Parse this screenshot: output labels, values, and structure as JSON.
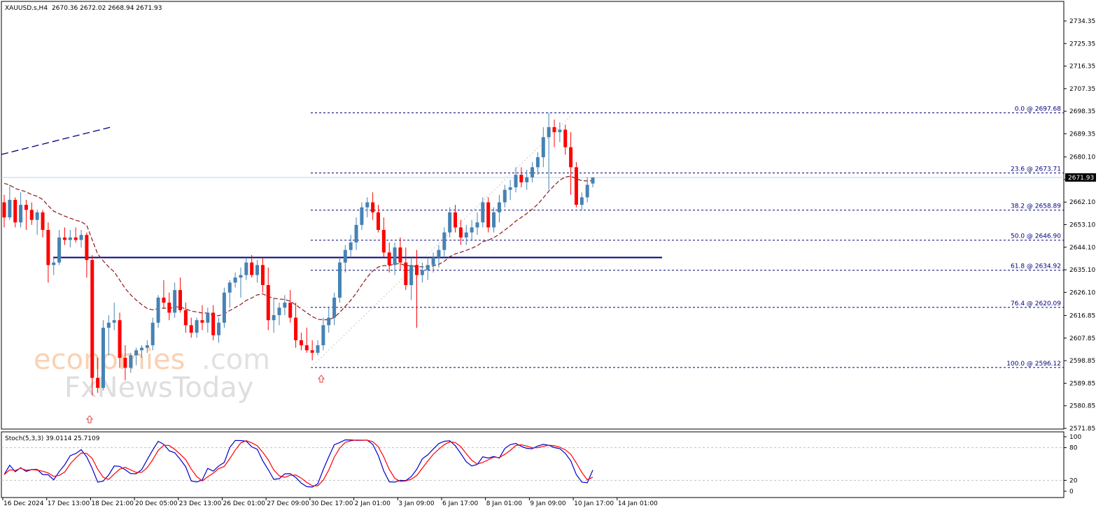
{
  "header": {
    "symbol": "XAUUSD.s,H4",
    "ohlc": "2670.36 2672.02 2668.94 2671.93"
  },
  "chart_data": {
    "type": "candlestick",
    "symbol": "XAUUSD.s",
    "timeframe": "H4",
    "price_axis": {
      "ticks": [
        "2734.35",
        "2725.35",
        "2716.35",
        "2707.35",
        "2698.35",
        "2689.35",
        "2680.10",
        "2671.10",
        "2662.10",
        "2653.10",
        "2644.10",
        "2635.10",
        "2626.10",
        "2616.85",
        "2607.85",
        "2598.85",
        "2589.85",
        "2580.85",
        "2571.85"
      ],
      "range": [
        2571.85,
        2739.0
      ]
    },
    "current_price": {
      "value": 2671.93,
      "label": "2671.93"
    },
    "time_axis": [
      "16 Dec 2024",
      "17 Dec 13:00",
      "18 Dec 21:00",
      "20 Dec 05:00",
      "23 Dec 13:00",
      "26 Dec 01:00",
      "27 Dec 09:00",
      "30 Dec 17:00",
      "2 Jan 01:00",
      "3 Jan 09:00",
      "6 Jan 17:00",
      "8 Jan 01:00",
      "9 Jan 09:00",
      "10 Jan 17:00",
      "14 Jan 01:00"
    ],
    "fibonacci": [
      {
        "label": "0.0 @ 2697.68",
        "price": 2697.68
      },
      {
        "label": "23.6 @ 2673.71",
        "price": 2673.71
      },
      {
        "label": "38.2 @ 2658.89",
        "price": 2658.89
      },
      {
        "label": "50.0 @ 2646.90",
        "price": 2646.9
      },
      {
        "label": "61.8 @ 2634.92",
        "price": 2634.92
      },
      {
        "label": "76.4 @ 2620.09",
        "price": 2620.09
      },
      {
        "label": "100.0 @ 2596.12",
        "price": 2596.12
      }
    ],
    "support_line": {
      "price": 2640.0
    },
    "colors": {
      "bull": "#4682b4",
      "bear": "#ff0000",
      "ma": "#8b1a1a",
      "fib": "#000080",
      "support": "#000080",
      "stoch_main": "#0000cd",
      "stoch_signal": "#ff0000"
    },
    "candles": [
      [
        2662,
        2665,
        2652,
        2656
      ],
      [
        2656,
        2669,
        2655,
        2663
      ],
      [
        2663,
        2664,
        2652,
        2654
      ],
      [
        2654,
        2666,
        2652,
        2661
      ],
      [
        2661,
        2663,
        2651,
        2659
      ],
      [
        2659,
        2662,
        2653,
        2655
      ],
      [
        2655,
        2659,
        2649,
        2658
      ],
      [
        2658,
        2659,
        2648,
        2651
      ],
      [
        2651,
        2654,
        2630,
        2637
      ],
      [
        2637,
        2640,
        2633,
        2638
      ],
      [
        2638,
        2651,
        2637,
        2648
      ],
      [
        2648,
        2652,
        2645,
        2647
      ],
      [
        2647,
        2651,
        2644,
        2648
      ],
      [
        2648,
        2652,
        2646,
        2647
      ],
      [
        2647,
        2651,
        2644,
        2649
      ],
      [
        2649,
        2650,
        2632,
        2639
      ],
      [
        2639,
        2641,
        2585,
        2592
      ],
      [
        2592,
        2600,
        2586,
        2588
      ],
      [
        2588,
        2615,
        2587,
        2612
      ],
      [
        2612,
        2617,
        2601,
        2614
      ],
      [
        2614,
        2622,
        2611,
        2615
      ],
      [
        2615,
        2618,
        2596,
        2600
      ],
      [
        2600,
        2605,
        2591,
        2596
      ],
      [
        2596,
        2602,
        2594,
        2601
      ],
      [
        2601,
        2604,
        2597,
        2603
      ],
      [
        2603,
        2605,
        2600,
        2604
      ],
      [
        2604,
        2607,
        2602,
        2605
      ],
      [
        2605,
        2616,
        2603,
        2614
      ],
      [
        2614,
        2625,
        2612,
        2624
      ],
      [
        2624,
        2631,
        2620,
        2622
      ],
      [
        2622,
        2626,
        2615,
        2618
      ],
      [
        2618,
        2630,
        2616,
        2627
      ],
      [
        2627,
        2632,
        2618,
        2619
      ],
      [
        2619,
        2622,
        2610,
        2613
      ],
      [
        2613,
        2616,
        2608,
        2610
      ],
      [
        2610,
        2616,
        2608,
        2615
      ],
      [
        2615,
        2621,
        2611,
        2614
      ],
      [
        2614,
        2620,
        2610,
        2618
      ],
      [
        2618,
        2621,
        2607,
        2609
      ],
      [
        2609,
        2616,
        2606,
        2614
      ],
      [
        2614,
        2628,
        2612,
        2626
      ],
      [
        2626,
        2631,
        2620,
        2630
      ],
      [
        2630,
        2634,
        2628,
        2632
      ],
      [
        2632,
        2636,
        2624,
        2633
      ],
      [
        2633,
        2640,
        2631,
        2638
      ],
      [
        2638,
        2641,
        2632,
        2633
      ],
      [
        2633,
        2639,
        2630,
        2637
      ],
      [
        2637,
        2640,
        2626,
        2629
      ],
      [
        2629,
        2636,
        2611,
        2615
      ],
      [
        2615,
        2624,
        2610,
        2617
      ],
      [
        2617,
        2622,
        2613,
        2620
      ],
      [
        2620,
        2625,
        2617,
        2622
      ],
      [
        2622,
        2627,
        2614,
        2616
      ],
      [
        2616,
        2622,
        2604,
        2607
      ],
      [
        2607,
        2610,
        2603,
        2605
      ],
      [
        2605,
        2612,
        2602,
        2603
      ],
      [
        2603,
        2607,
        2599,
        2602
      ],
      [
        2602,
        2607,
        2601,
        2605
      ],
      [
        2605,
        2616,
        2603,
        2613
      ],
      [
        2613,
        2620,
        2610,
        2616
      ],
      [
        2616,
        2626,
        2613,
        2624
      ],
      [
        2624,
        2640,
        2622,
        2638
      ],
      [
        2638,
        2645,
        2634,
        2643
      ],
      [
        2643,
        2649,
        2640,
        2646
      ],
      [
        2646,
        2656,
        2643,
        2653
      ],
      [
        2653,
        2662,
        2651,
        2660
      ],
      [
        2660,
        2664,
        2656,
        2662
      ],
      [
        2662,
        2666,
        2655,
        2658
      ],
      [
        2658,
        2661,
        2650,
        2651
      ],
      [
        2651,
        2656,
        2640,
        2642
      ],
      [
        2642,
        2646,
        2634,
        2637
      ],
      [
        2637,
        2646,
        2633,
        2644
      ],
      [
        2644,
        2648,
        2635,
        2638
      ],
      [
        2638,
        2644,
        2627,
        2629
      ],
      [
        2629,
        2640,
        2623,
        2637
      ],
      [
        2637,
        2643,
        2612,
        2633
      ],
      [
        2633,
        2638,
        2630,
        2635
      ],
      [
        2635,
        2640,
        2631,
        2637
      ],
      [
        2637,
        2642,
        2634,
        2640
      ],
      [
        2640,
        2645,
        2636,
        2643
      ],
      [
        2643,
        2652,
        2640,
        2650
      ],
      [
        2650,
        2660,
        2648,
        2658
      ],
      [
        2658,
        2661,
        2650,
        2652
      ],
      [
        2652,
        2655,
        2645,
        2648
      ],
      [
        2648,
        2653,
        2645,
        2650
      ],
      [
        2650,
        2655,
        2647,
        2652
      ],
      [
        2652,
        2658,
        2649,
        2654
      ],
      [
        2654,
        2664,
        2652,
        2662
      ],
      [
        2662,
        2664,
        2650,
        2652
      ],
      [
        2652,
        2660,
        2650,
        2658
      ],
      [
        2658,
        2665,
        2654,
        2662
      ],
      [
        2662,
        2669,
        2660,
        2667
      ],
      [
        2667,
        2671,
        2663,
        2668
      ],
      [
        2668,
        2676,
        2666,
        2673
      ],
      [
        2673,
        2676,
        2668,
        2670
      ],
      [
        2670,
        2675,
        2667,
        2672
      ],
      [
        2672,
        2678,
        2670,
        2676
      ],
      [
        2676,
        2682,
        2673,
        2680
      ],
      [
        2680,
        2692,
        2676,
        2688
      ],
      [
        2688,
        2697.68,
        2667,
        2692
      ],
      [
        2692,
        2695,
        2684,
        2690
      ],
      [
        2690,
        2694,
        2686,
        2691
      ],
      [
        2691,
        2693,
        2681,
        2684
      ],
      [
        2684,
        2690,
        2665,
        2676
      ],
      [
        2676,
        2678,
        2660,
        2661
      ],
      [
        2661,
        2666,
        2659,
        2664
      ],
      [
        2664,
        2672,
        2662,
        2669
      ],
      [
        2669.5,
        2672.02,
        2668,
        2671.93
      ]
    ],
    "ma_start": 2671,
    "stochastic": {
      "label": "Stoch(5,3,3) 39.0114 25.7109",
      "main_value": 39.0114,
      "signal_value": 25.7109,
      "levels": [
        20,
        80
      ],
      "axis_ticks": [
        "100",
        "80",
        "20",
        "0"
      ]
    }
  }
}
